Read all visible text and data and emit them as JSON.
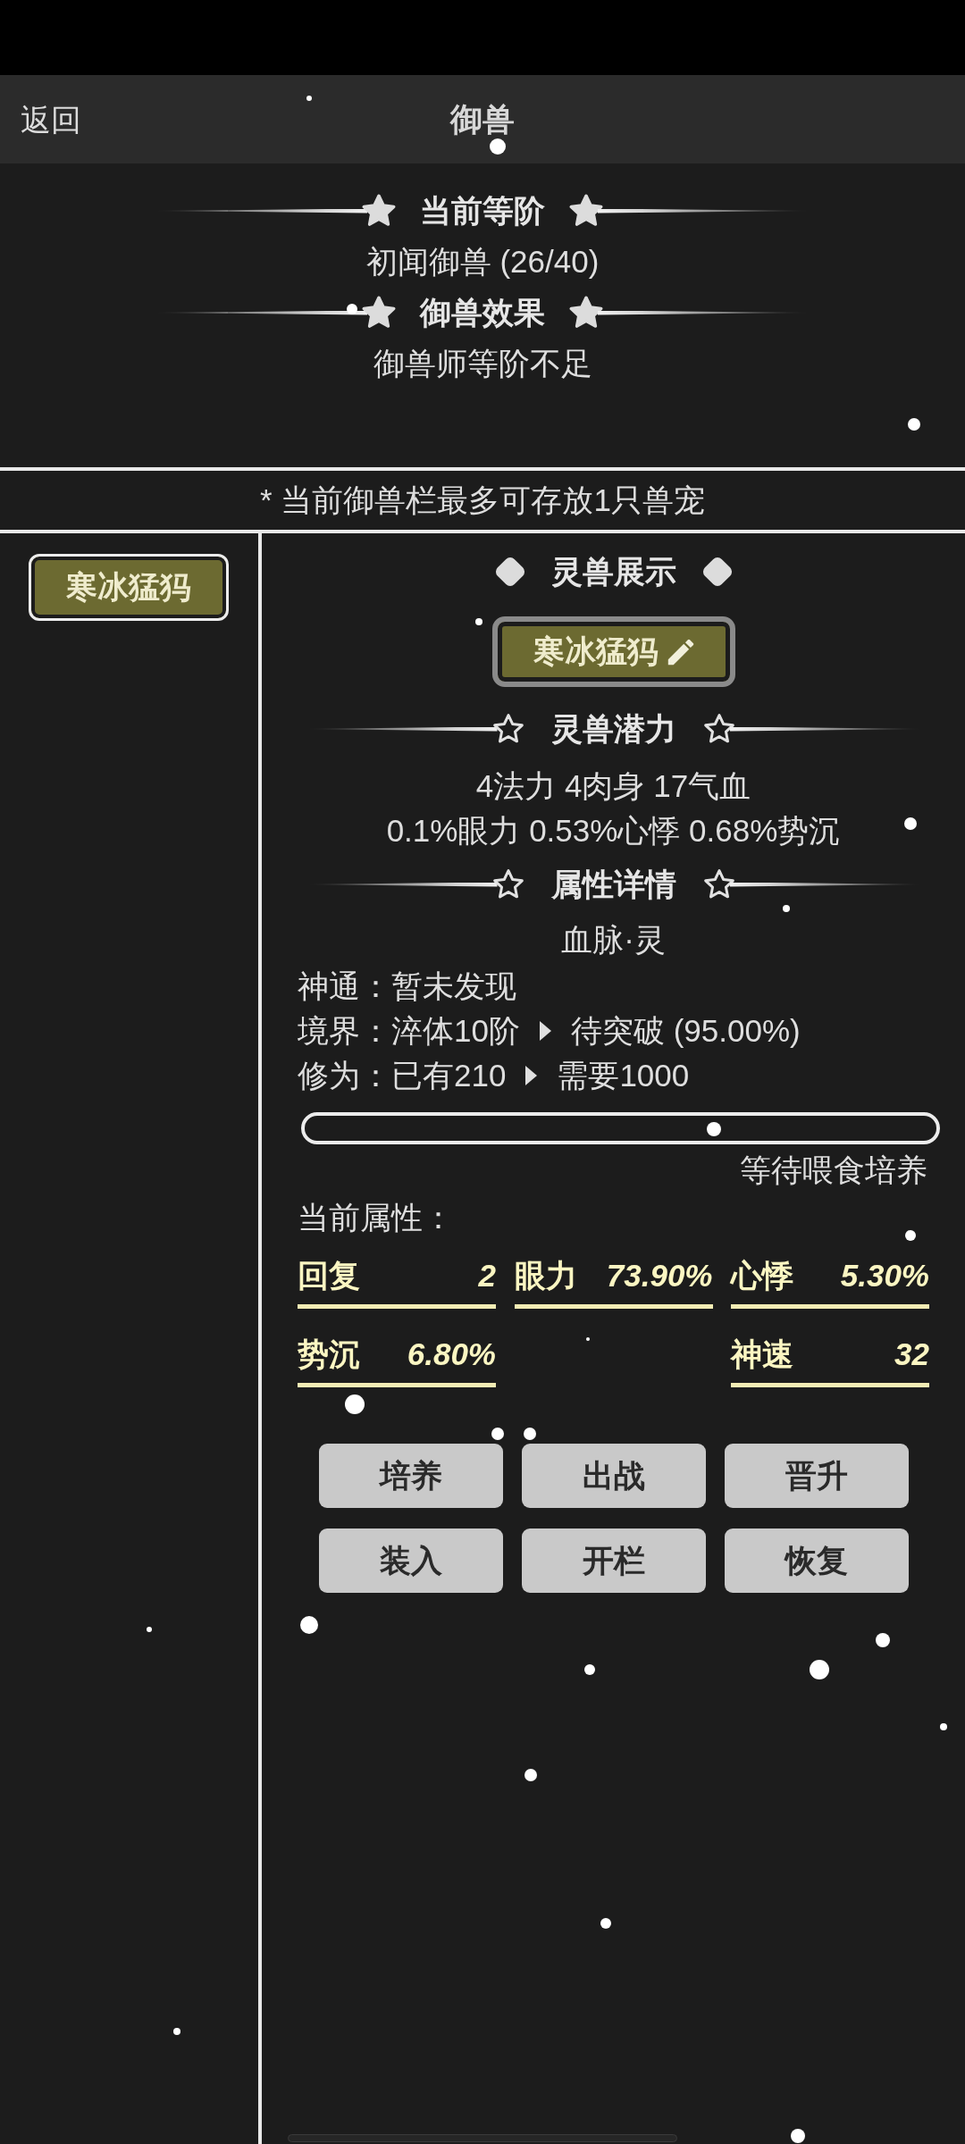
{
  "header": {
    "back": "返回",
    "title": "御兽"
  },
  "rank": {
    "sections": [
      {
        "heading": "当前等阶",
        "text": "初闻御兽 (26/40)"
      },
      {
        "heading": "御兽效果",
        "text": "御兽师等阶不足"
      }
    ]
  },
  "notice": "* 当前御兽栏最多可存放1只兽宠",
  "beast_list": [
    {
      "name": "寒冰猛犸",
      "selected": true
    }
  ],
  "showcase": {
    "heading": "灵兽展示",
    "name": "寒冰猛犸"
  },
  "potential": {
    "heading": "灵兽潜力",
    "lines": [
      "4法力 4肉身 17气血",
      "0.1%眼力 0.53%心悸 0.68%势沉"
    ]
  },
  "details": {
    "heading": "属性详情",
    "bloodline": "血脉·灵",
    "rows": [
      {
        "label": "神通：",
        "parts": [
          "暂未发现"
        ]
      },
      {
        "label": "境界：",
        "parts": [
          "淬体10阶",
          "待突破 (95.00%)"
        ]
      },
      {
        "label": "修为：",
        "parts": [
          "已有210",
          "需要1000"
        ]
      }
    ]
  },
  "progress": {
    "caption": "等待喂食培养"
  },
  "attributes": {
    "title": "当前属性：",
    "rows": [
      [
        {
          "label": "回复",
          "value": "2"
        },
        {
          "label": "眼力",
          "value": "73.90%"
        },
        {
          "label": "心悸",
          "value": "5.30%"
        }
      ],
      [
        {
          "label": "势沉",
          "value": "6.80%"
        },
        "",
        {
          "label": "神速",
          "value": "32"
        }
      ]
    ]
  },
  "actions": [
    "培养",
    "出战",
    "晋升",
    "装入",
    "开栏",
    "恢复"
  ]
}
